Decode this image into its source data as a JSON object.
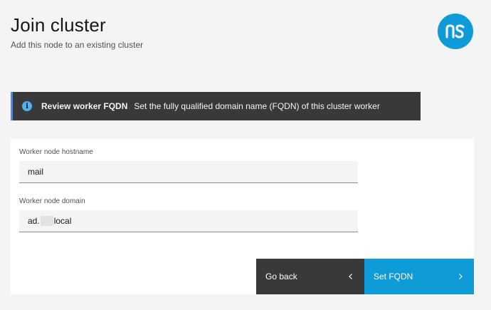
{
  "header": {
    "title": "Join cluster",
    "subtitle": "Add this node to an existing cluster"
  },
  "notification": {
    "title": "Review worker FQDN",
    "message": "Set the fully qualified domain name (FQDN) of this cluster worker"
  },
  "form": {
    "hostname": {
      "label": "Worker node hostname",
      "value": "mail"
    },
    "domain": {
      "label": "Worker node domain",
      "value_prefix": "ad.",
      "value_suffix": "local"
    }
  },
  "actions": {
    "back_label": "Go back",
    "primary_label": "Set FQDN"
  },
  "colors": {
    "accent": "#0f9bd7",
    "dark": "#393939",
    "info": "#4fb3f0"
  },
  "icons": {
    "logo": "ns8-logo",
    "info": "information-icon",
    "back": "chevron-left-icon",
    "next": "chevron-right-icon"
  }
}
